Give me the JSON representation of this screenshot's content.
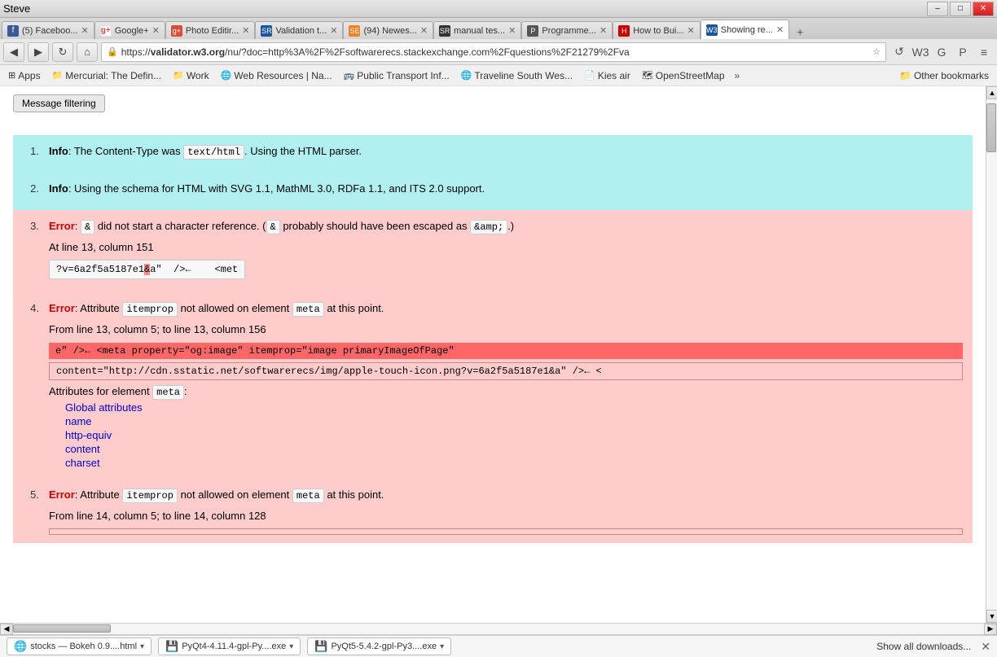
{
  "titlebar": {
    "title": "Steve",
    "controls": {
      "minimize": "–",
      "maximize": "□",
      "close": "✕"
    }
  },
  "tabs": [
    {
      "id": "tab-facebook",
      "favicon": "fb",
      "label": "(5) Faceboo...",
      "active": false
    },
    {
      "id": "tab-google",
      "favicon": "g+",
      "label": "Google+",
      "active": false
    },
    {
      "id": "tab-photo",
      "favicon": "pe",
      "label": "Photo Editir...",
      "active": false
    },
    {
      "id": "tab-validation",
      "favicon": "val",
      "label": "Validation t...",
      "active": false
    },
    {
      "id": "tab-newest",
      "favicon": "se",
      "label": "(94) Newes...",
      "active": false
    },
    {
      "id": "tab-manual",
      "favicon": "m",
      "label": "manual tes...",
      "active": false
    },
    {
      "id": "tab-prog",
      "favicon": "prog",
      "label": "Programme...",
      "active": false
    },
    {
      "id": "tab-how",
      "favicon": "how",
      "label": "How to Bui...",
      "active": false
    },
    {
      "id": "tab-showing",
      "favicon": "w3",
      "label": "Showing re...",
      "active": true
    }
  ],
  "addressbar": {
    "back": "◀",
    "forward": "▶",
    "refresh": "↻",
    "home": "⌂",
    "url_display": "https://validator.w3.org/nu/?doc=http%3A%2F%2Fsoftwarerecs.stackexchange.com%2Fquestions%2F21279%2Fva",
    "url_domain": "validator.w3.org",
    "icons": [
      "🔒",
      "✏",
      "W3",
      "G",
      "P",
      "≡"
    ]
  },
  "bookmarks": [
    {
      "id": "bm-apps",
      "icon": "⊞",
      "label": "Apps"
    },
    {
      "id": "bm-mercurial",
      "icon": "📁",
      "label": "Mercurial: The Defin..."
    },
    {
      "id": "bm-work",
      "icon": "📁",
      "label": "Work"
    },
    {
      "id": "bm-webres",
      "icon": "🌐",
      "label": "Web Resources | Na..."
    },
    {
      "id": "bm-transport",
      "icon": "🚌",
      "label": "Public Transport Inf..."
    },
    {
      "id": "bm-traveline",
      "icon": "🌐",
      "label": "Traveline South Wes..."
    },
    {
      "id": "bm-kiesair",
      "icon": "📄",
      "label": "Kies air"
    },
    {
      "id": "bm-osm",
      "icon": "🗺",
      "label": "OpenStreetMap"
    }
  ],
  "bookmarks_more": "»",
  "bookmarks_other": "Other bookmarks",
  "page": {
    "filter_btn": "Message filtering",
    "items": [
      {
        "num": "1.",
        "type": "info",
        "label": "Info",
        "message": ": The Content-Type was ",
        "code1": "text/html",
        "message2": ". Using the HTML parser."
      },
      {
        "num": "2.",
        "type": "info",
        "label": "Info",
        "message": ": Using the schema for HTML with SVG 1.1, MathML 3.0, RDFa 1.1, and ITS 2.0 support."
      },
      {
        "num": "3.",
        "type": "error",
        "label": "Error",
        "message": ": ",
        "code1": "&",
        "message2": " did not start a character reference. (",
        "code2": "&",
        "message3": " probably should have been escaped as ",
        "code3": "&amp;",
        "message4": ".)",
        "location": "At line 13, column 151",
        "code_snippet": "?v=6a2f5a5187e1",
        "code_hl": "&",
        "code_after": "a\"  />←    <met"
      },
      {
        "num": "4.",
        "type": "error",
        "label": "Error",
        "message": ": Attribute ",
        "code1": "itemprop",
        "message2": " not allowed on element ",
        "code2": "meta",
        "message3": " at this point.",
        "location": "From line 13, column 5; to line 13, column 156",
        "code_line1": "e\" />←      <meta property=\"og:image\" itemprop=\"image primaryImageOfPage\"",
        "code_line2": "content=\"http://cdn.sstatic.net/softwarerecs/img/apple-touch-icon.png?v=6a2f5a5187e1&a\" />←    <",
        "attr_for": "meta",
        "attrs": {
          "global": "Global attributes",
          "items": [
            "name",
            "http-equiv",
            "content",
            "charset"
          ]
        }
      },
      {
        "num": "5.",
        "type": "error",
        "label": "Error",
        "message": ": Attribute ",
        "code1": "itemprop",
        "message2": " not allowed on element ",
        "code2": "meta",
        "message3": " at this point.",
        "location": "From line 14, column 5; to line 14, column 128"
      }
    ]
  },
  "scrollbar": {
    "up": "▲",
    "down": "▼"
  },
  "hscrollbar": {
    "left": "◀",
    "right": "▶"
  },
  "downloads": [
    {
      "id": "dl-bokeh",
      "icon": "🌐",
      "label": "stocks — Bokeh 0.9....html"
    },
    {
      "id": "dl-pyqt4",
      "icon": "💾",
      "label": "PyQt4-4.11.4-gpl-Py....exe"
    },
    {
      "id": "dl-pyqt5",
      "icon": "💾",
      "label": "PyQt5-5.4.2-gpl-Py3....exe"
    }
  ],
  "show_all_label": "Show all downloads...",
  "close_downloads": "✕"
}
